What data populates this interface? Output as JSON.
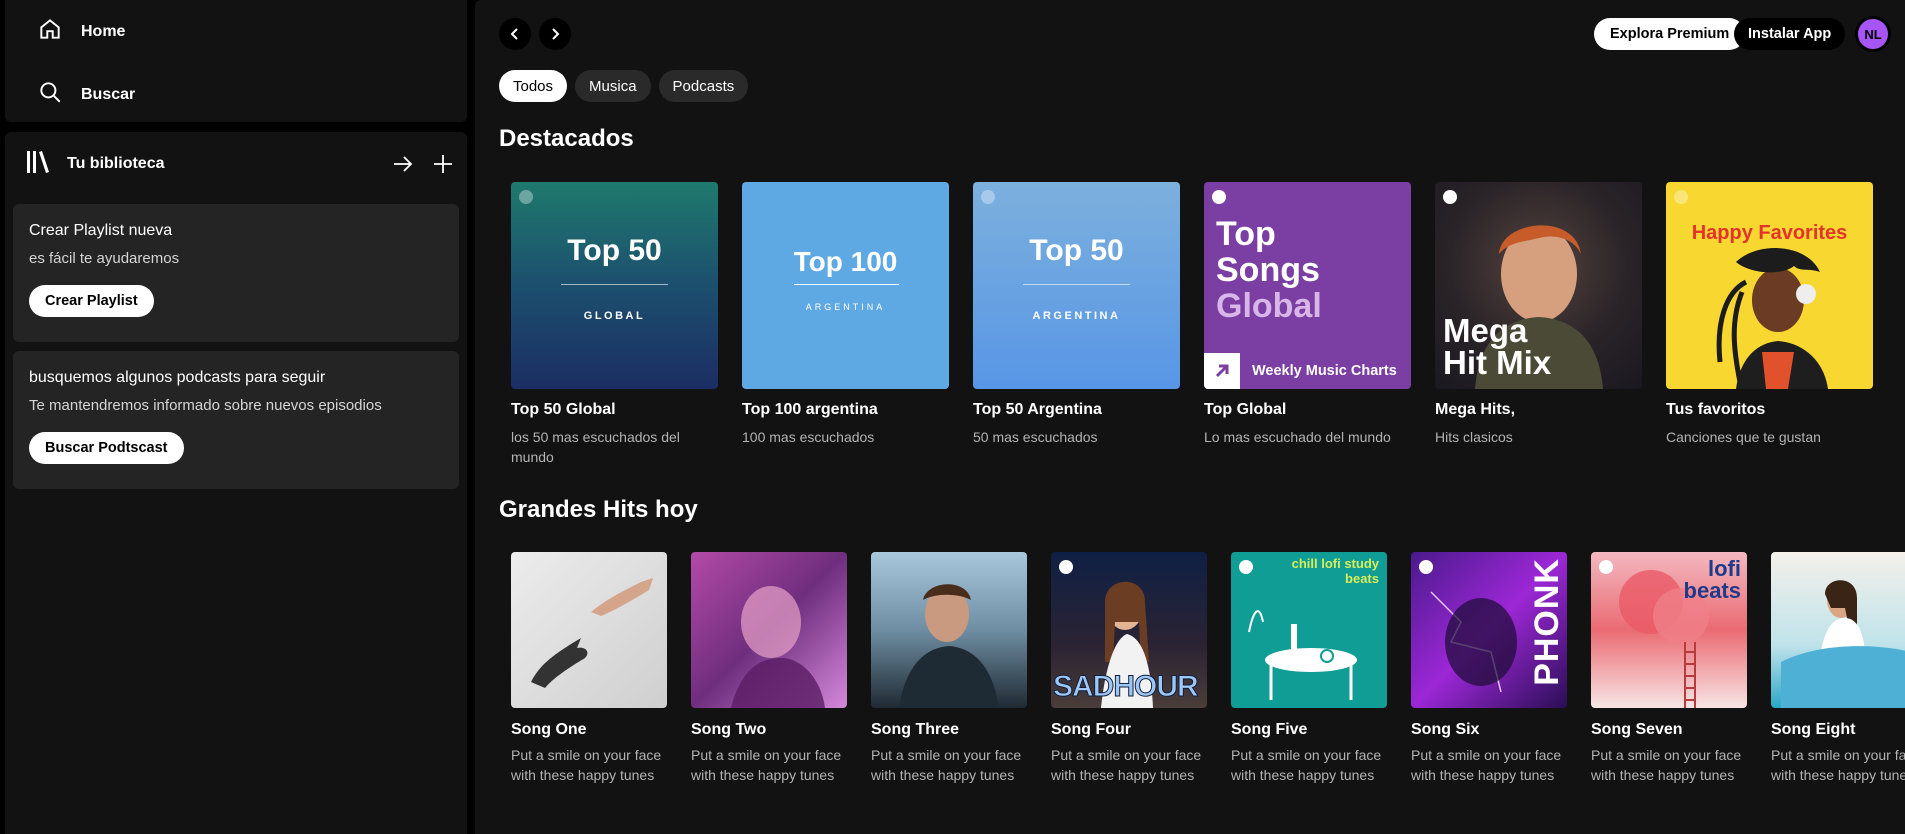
{
  "sidebar": {
    "nav": {
      "home": "Home",
      "search": "Buscar"
    },
    "library": {
      "title": "Tu biblioteca",
      "cards": [
        {
          "title": "Crear Playlist nueva",
          "subtitle": "es fácil te ayudaremos",
          "button": "Crear Playlist"
        },
        {
          "title": "busquemos algunos podcasts para seguir",
          "subtitle": "Te mantendremos informado sobre nuevos episodios",
          "button": "Buscar Podtscast"
        }
      ]
    }
  },
  "topbar": {
    "premium": "Explora Premium",
    "install": "Instalar App",
    "avatar": "NL"
  },
  "chips": [
    "Todos",
    "Musica",
    "Podcasts"
  ],
  "sections": {
    "featured": {
      "title": "Destacados",
      "items": [
        {
          "name": "Top 50 Global",
          "desc": "los 50 mas escuchados del mundo",
          "art": {
            "big": "Top 50",
            "small": "GLOBAL"
          }
        },
        {
          "name": "Top 100 argentina",
          "desc": "100 mas escuchados",
          "art": {
            "big": "Top 100",
            "small": "ARGENTINA"
          }
        },
        {
          "name": "Top 50 Argentina",
          "desc": "50 mas escuchados",
          "art": {
            "big": "Top 50",
            "small": "ARGENTINA"
          }
        },
        {
          "name": "Top Global",
          "desc": "Lo mas escuchado del mundo",
          "art": {
            "line1": "Top",
            "line2": "Songs",
            "line3": "Global",
            "footer": "Weekly Music Charts"
          }
        },
        {
          "name": "Mega Hits,",
          "desc": "Hits clasicos",
          "art": {
            "line1": "Mega",
            "line2": "Hit Mix"
          }
        },
        {
          "name": "Tus favoritos",
          "desc": "Canciones que te gustan",
          "art": {
            "big": "Happy Favorites"
          }
        }
      ]
    },
    "hits": {
      "title": "Grandes Hits hoy",
      "items": [
        {
          "name": "Song One",
          "desc": "Put a smile on your face with these happy tunes"
        },
        {
          "name": "Song Two",
          "desc": "Put a smile on your face with these happy tunes"
        },
        {
          "name": "Song Three",
          "desc": "Put a smile on your face with these happy tunes"
        },
        {
          "name": "Song Four",
          "desc": "Put a smile on your face with these happy tunes",
          "art": "SADHOUR"
        },
        {
          "name": "Song Five",
          "desc": "Put a smile on your face with these happy tunes",
          "art": "chill lofi study beats"
        },
        {
          "name": "Song Six",
          "desc": "Put a smile on your face with these happy tunes",
          "art": "PHONK"
        },
        {
          "name": "Song Seven",
          "desc": "Put a smile on your face with these happy tunes",
          "art": "lofi beats"
        },
        {
          "name": "Song Eight",
          "desc": "Put a smile on your face with these happy tunes"
        }
      ]
    }
  }
}
